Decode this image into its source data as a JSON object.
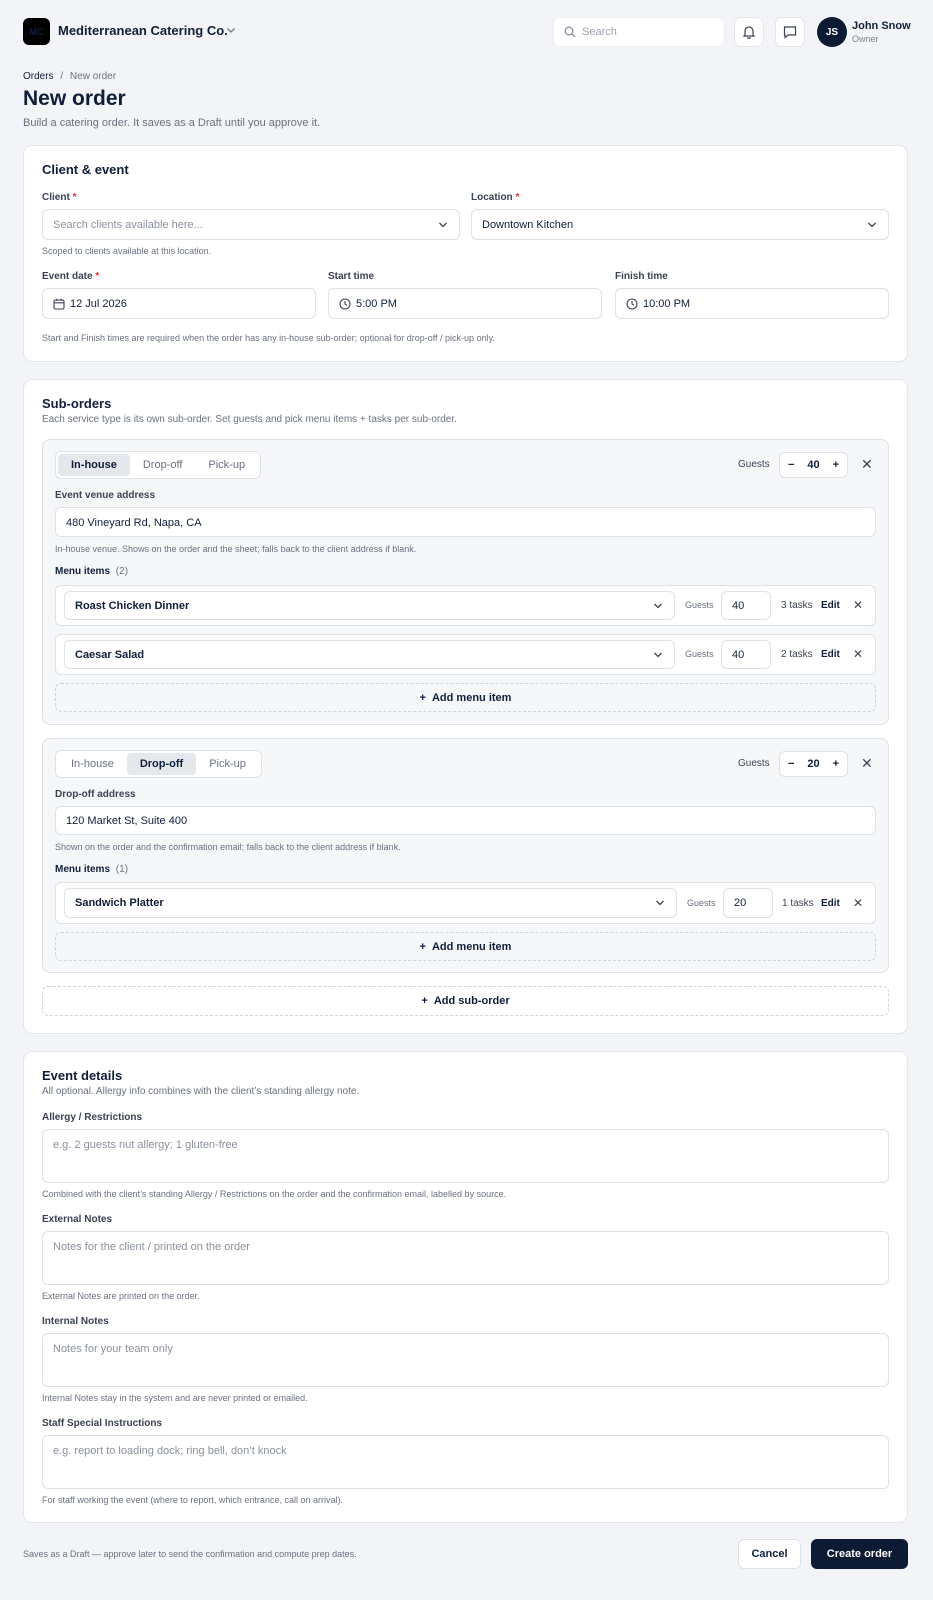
{
  "header": {
    "logo_text": "MC",
    "company": "Mediterranean Catering Co.",
    "search_placeholder": "Search",
    "user_initials": "JS",
    "user_name": "John Snow",
    "user_role": "Owner"
  },
  "breadcrumb": {
    "root": "Orders",
    "separator": "/",
    "current": "New order"
  },
  "page": {
    "title": "New order",
    "subtitle": "Build a catering order. It saves as a Draft until you approve it."
  },
  "client_event": {
    "title": "Client & event",
    "client_label": "Client",
    "client_placeholder": "Search clients available here...",
    "client_help": "Scoped to clients available at this location.",
    "location_label": "Location",
    "location_value": "Downtown Kitchen",
    "required_mark": "*",
    "date_label": "Event date",
    "date_value": "12 Jul 2026",
    "start_label": "Start time",
    "start_value": "5:00 PM",
    "finish_label": "Finish time",
    "finish_value": "10:00 PM",
    "times_help": "Start and Finish times are required when the order has any in-house sub-order; optional for drop-off / pick-up only."
  },
  "suborders": {
    "title": "Sub-orders",
    "subtitle": "Each service type is its own sub-order. Set guests and pick menu items + tasks per sub-order.",
    "tabs": [
      "In-house",
      "Drop-off",
      "Pick-up"
    ],
    "guests_label": "Guests",
    "menu_label": "Menu items",
    "add_item": "Add menu item",
    "add_suborder": "Add sub-order",
    "edit_label": "Edit",
    "items": [
      {
        "active": "In-house",
        "guests": "40",
        "address_label": "Event venue address",
        "address": "480 Vineyard Rd, Napa, CA",
        "address_help": "In-house venue. Shows on the order and the sheet; falls back to the client address if blank.",
        "count": "(2)",
        "menu": [
          {
            "name": "Roast Chicken Dinner",
            "guests": "40",
            "tasks": "3 tasks"
          },
          {
            "name": "Caesar Salad",
            "guests": "40",
            "tasks": "2 tasks"
          }
        ]
      },
      {
        "active": "Drop-off",
        "guests": "20",
        "address_label": "Drop-off address",
        "address": "120 Market St, Suite 400",
        "address_help": "Shown on the order and the confirmation email; falls back to the client address if blank.",
        "count": "(1)",
        "menu": [
          {
            "name": "Sandwich Platter",
            "guests": "20",
            "tasks": "1 tasks"
          }
        ]
      }
    ]
  },
  "event_details": {
    "title": "Event details",
    "subtitle": "All optional. Allergy info combines with the client’s standing allergy note.",
    "fields": [
      {
        "label": "Allergy / Restrictions",
        "placeholder": "e.g. 2 guests nut allergy; 1 gluten-free",
        "help": "Combined with the client’s standing Allergy / Restrictions on the order and the confirmation email, labelled by source."
      },
      {
        "label": "External Notes",
        "placeholder": "Notes for the client / printed on the order",
        "help": "External Notes are printed on the order."
      },
      {
        "label": "Internal Notes",
        "placeholder": "Notes for your team only",
        "help": "Internal Notes stay in the system and are never printed or emailed."
      },
      {
        "label": "Staff Special Instructions",
        "placeholder": "e.g. report to loading dock; ring bell, don’t knock",
        "help": "For staff working the event (where to report, which entrance, call on arrival)."
      }
    ]
  },
  "footer": {
    "note": "Saves as a Draft — approve later to send the confirmation and compute prep dates.",
    "cancel": "Cancel",
    "create": "Create order"
  }
}
